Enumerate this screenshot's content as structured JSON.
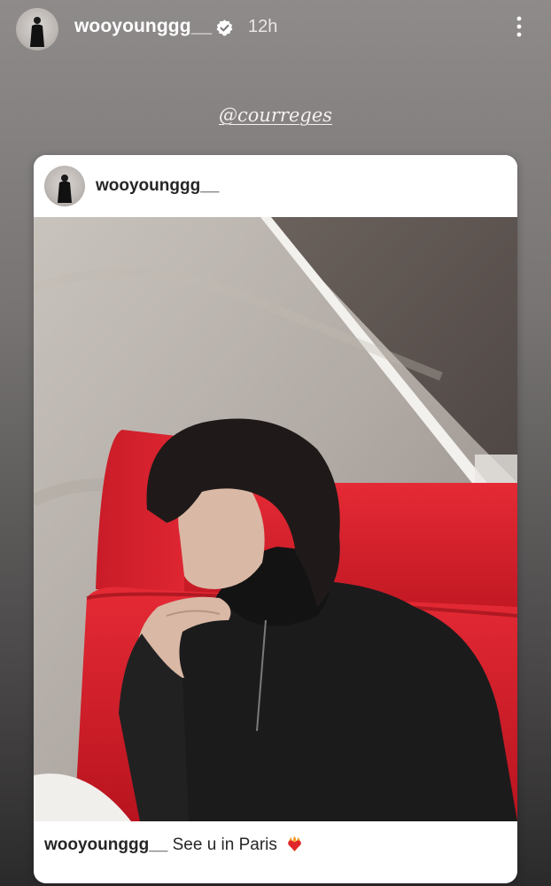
{
  "story": {
    "username": "wooyounggg__",
    "time": "12h",
    "mention": "@courreges"
  },
  "post": {
    "username": "wooyounggg__",
    "caption_user": "wooyounggg__",
    "caption_text": "See u in Paris"
  },
  "icons": {
    "verified": "verified-badge-icon",
    "more": "more-options-icon",
    "carousel": "multiple-photos-icon",
    "emoji": "heart-on-fire-emoji"
  },
  "colors": {
    "background_top": "#8e8b8a",
    "background_bottom": "#2b2a2a",
    "card": "#ffffff",
    "text_dark": "#262626",
    "verified_bg": "#ffffff",
    "chair_red": "#d8232f"
  }
}
